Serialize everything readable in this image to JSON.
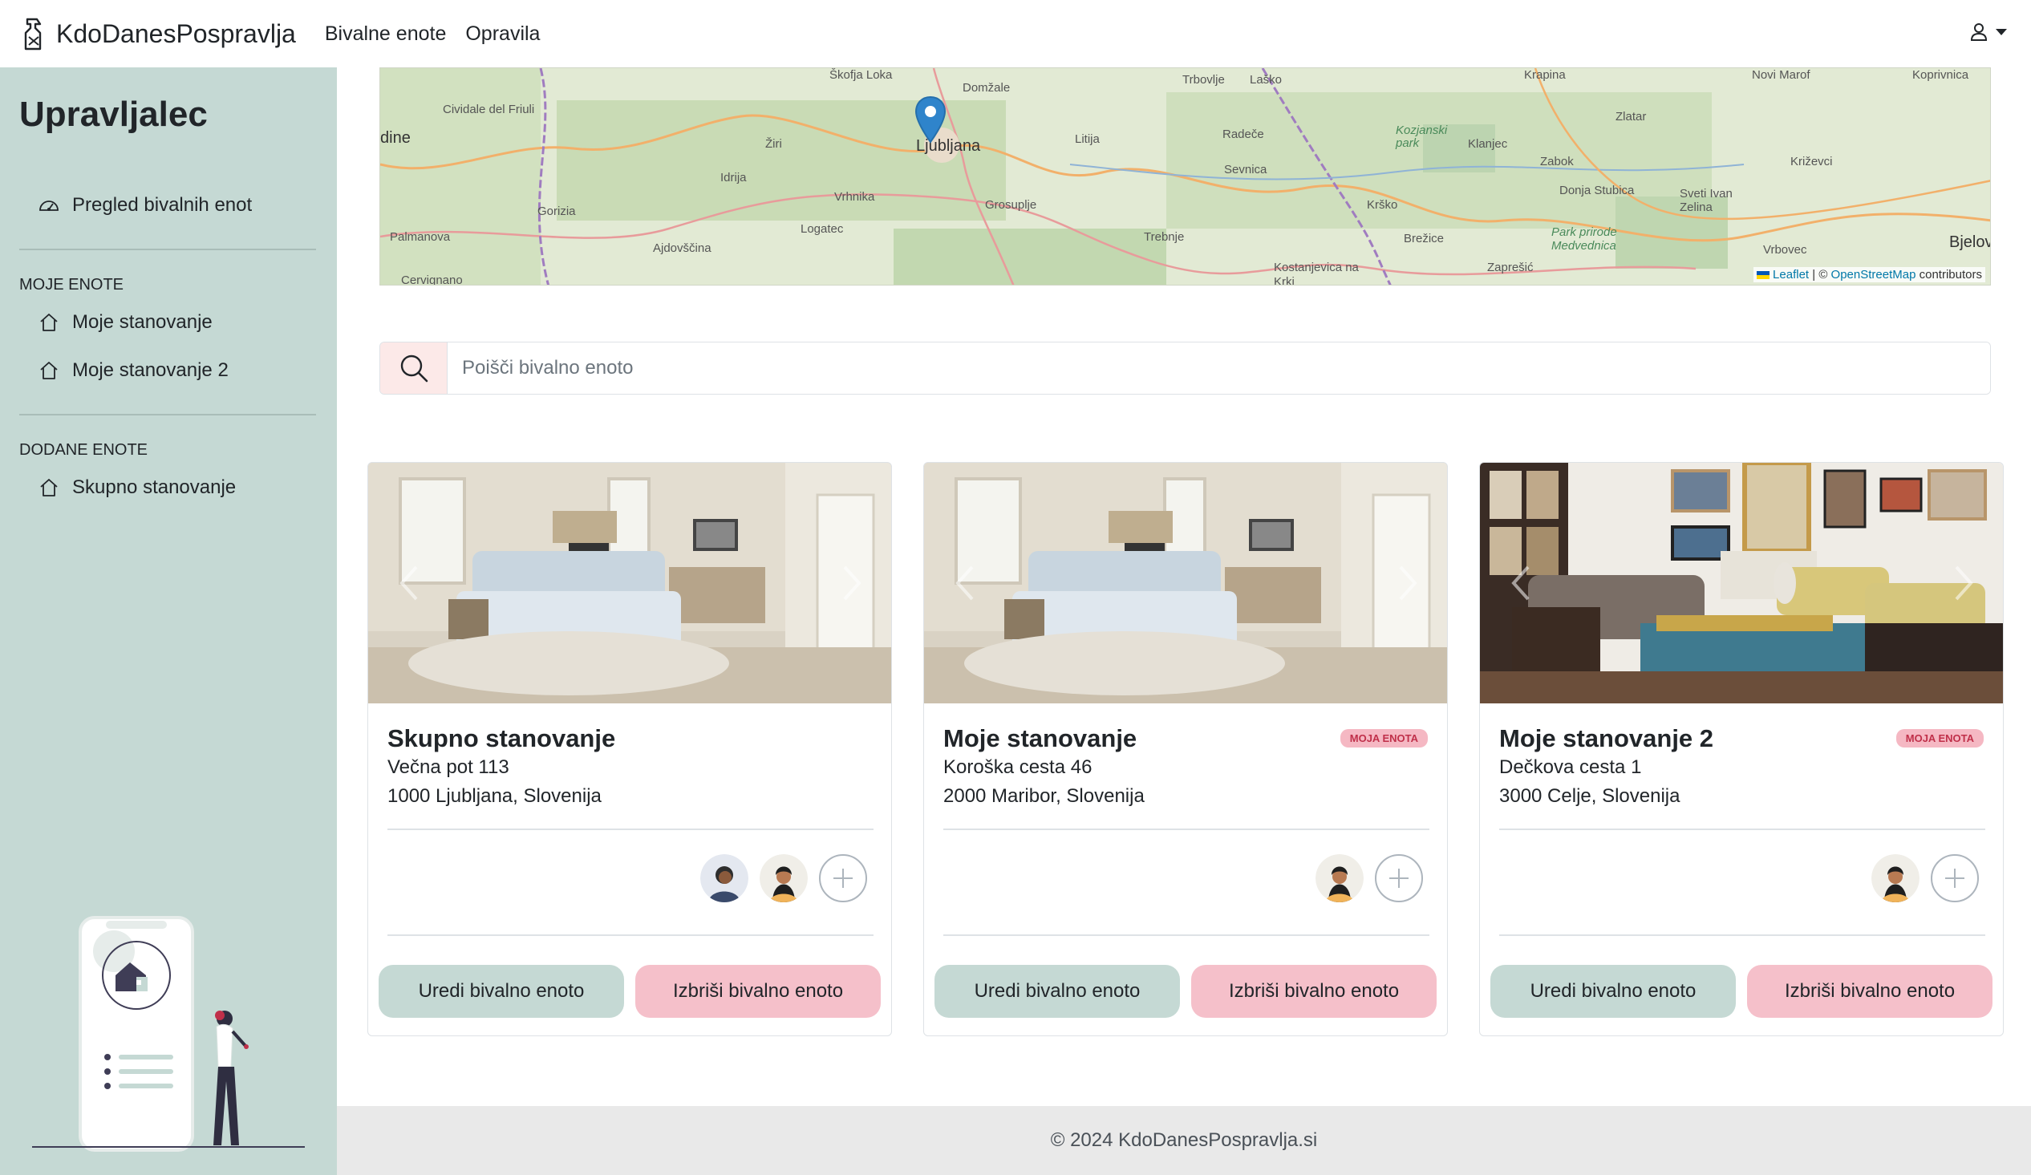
{
  "navbar": {
    "brand": "KdoDanesPospravlja",
    "links": [
      "Bivalne enote",
      "Opravila"
    ]
  },
  "sidebar": {
    "title": "Upravljalec",
    "overview": "Pregled bivalnih enot",
    "my_units_heading": "MOJE ENOTE",
    "my_units": [
      "Moje stanovanje",
      "Moje stanovanje 2"
    ],
    "added_units_heading": "DODANE ENOTE",
    "added_units": [
      "Skupno stanovanje"
    ]
  },
  "map": {
    "places": [
      "Škofja Loka",
      "Domžale",
      "Trbovlje",
      "Laško",
      "Krapina",
      "Novi Marof",
      "Koprivnica",
      "Cividale del Friuli",
      "dine",
      "Žiri",
      "Ljubljana",
      "Litija",
      "Radeče",
      "Kozjanski park",
      "Klanjec",
      "Zlatar",
      "Zabok",
      "Križevci",
      "Idrija",
      "Vrhnika",
      "Grosuplje",
      "Sevnica",
      "Donja Stubica",
      "Sveti Ivan Zelina",
      "Gorizia",
      "Logatec",
      "Krško",
      "Palmanova",
      "Ajdovščina",
      "Trebnje",
      "Brežice",
      "Park prirode Medvednica",
      "Vrbovec",
      "Bjelova",
      "Kostanjevica na Krki",
      "Zaprešić",
      "Cervignano"
    ],
    "attribution_leaflet": "Leaflet",
    "attribution_sep": " | © ",
    "attribution_osm": "OpenStreetMap",
    "attribution_tail": " contributors"
  },
  "search": {
    "placeholder": "Poišči bivalno enoto"
  },
  "cards": [
    {
      "title": "Skupno stanovanje",
      "street": "Večna pot 113",
      "city": "1000 Ljubljana, Slovenija",
      "badge": "",
      "members": 2,
      "edit_label": "Uredi bivalno enoto",
      "delete_label": "Izbriši bivalno enoto"
    },
    {
      "title": "Moje stanovanje",
      "street": "Koroška cesta 46",
      "city": "2000 Maribor, Slovenija",
      "badge": "MOJA ENOTA",
      "members": 1,
      "edit_label": "Uredi bivalno enoto",
      "delete_label": "Izbriši bivalno enoto"
    },
    {
      "title": "Moje stanovanje 2",
      "street": "Dečkova cesta 1",
      "city": "3000 Celje, Slovenija",
      "badge": "MOJA ENOTA",
      "members": 1,
      "edit_label": "Uredi bivalno enoto",
      "delete_label": "Izbriši bivalno enoto"
    }
  ],
  "footer": {
    "text": "© 2024 KdoDanesPospravlja.si"
  },
  "colors": {
    "sidebar": "#c5d9d4",
    "edit_button": "#c5d9d4",
    "delete_button": "#f5c0ca",
    "badge_bg": "#f5b8c3",
    "badge_text": "#c0304a"
  }
}
